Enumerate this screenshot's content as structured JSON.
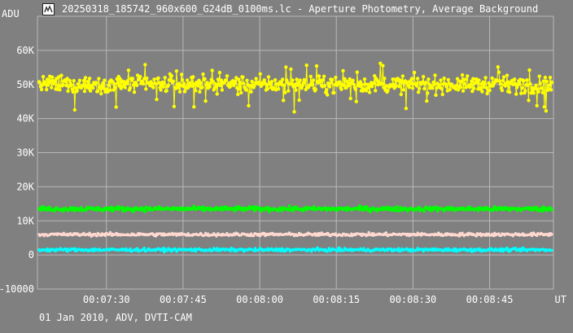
{
  "window": {
    "title": "20250318_185742_960x600_G24dB_0100ms.lc - Aperture Photometry, Average Background",
    "app_icon": "lightcurve-app-icon"
  },
  "footer": {
    "caption": "01 Jan 2010, ADV, DVTI-CAM"
  },
  "colors": {
    "background": "#808080",
    "grid": "#b8b8b8",
    "text": "#ffffff"
  },
  "chart_data": {
    "type": "line",
    "title": "20250318_185742_960x600_G24dB_0100ms.lc - Aperture Photometry, Average Background",
    "ylabel": "ADU",
    "xlabel": "UT",
    "ylim": [
      -10000,
      70000
    ],
    "y_ticks": [
      {
        "value": 60000,
        "label": "60K"
      },
      {
        "value": 50000,
        "label": "50K"
      },
      {
        "value": 40000,
        "label": "40K"
      },
      {
        "value": 30000,
        "label": "30K"
      },
      {
        "value": 20000,
        "label": "20K"
      },
      {
        "value": 10000,
        "label": "10K"
      },
      {
        "value": 0,
        "label": "0"
      },
      {
        "value": -10000,
        "label": "-10000"
      }
    ],
    "x_ticks": [
      "00:07:30",
      "00:07:45",
      "00:08:00",
      "00:08:15",
      "00:08:30",
      "00:08:45"
    ],
    "x_tick_seconds": [
      450,
      465,
      480,
      495,
      510,
      525
    ],
    "xlim_seconds": [
      436.5,
      537.5
    ],
    "grid": true,
    "legend": "none",
    "series": [
      {
        "color": "#ffff00",
        "mean": 50000,
        "spread": 2600,
        "marker_size": 2.2,
        "line": true,
        "spikes": true
      },
      {
        "color": "#00ff00",
        "mean": 13500,
        "spread": 700,
        "marker_size": 1.8,
        "line": true,
        "spikes": false
      },
      {
        "color": "#ffd8d0",
        "mean": 6000,
        "spread": 500,
        "marker_size": 1.6,
        "line": true,
        "spikes": false
      },
      {
        "color": "#00ffff",
        "mean": 1500,
        "spread": 450,
        "marker_size": 1.7,
        "line": true,
        "spikes": false
      }
    ]
  }
}
